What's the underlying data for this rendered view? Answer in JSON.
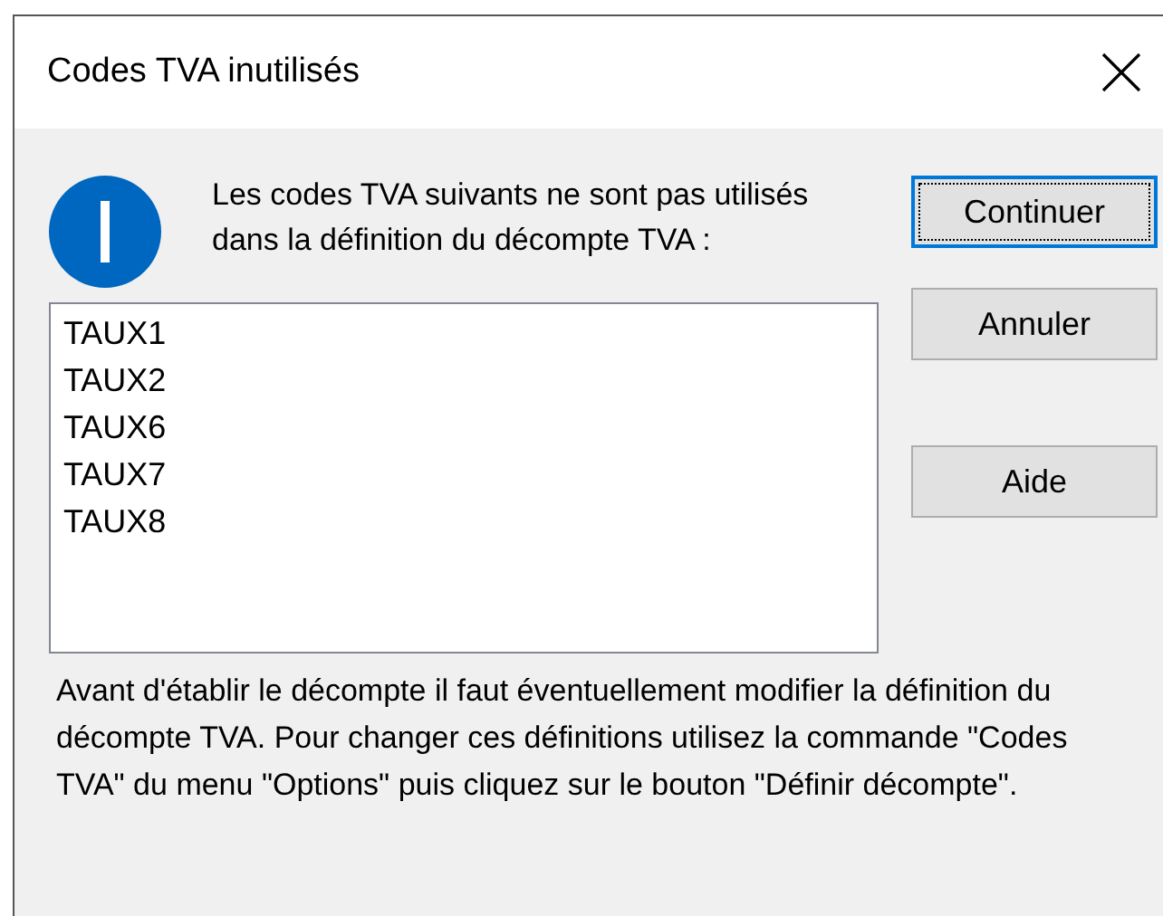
{
  "window": {
    "title": "Codes TVA inutilisés"
  },
  "message": "Les codes TVA suivants ne sont pas utilisés dans la définition du décompte TVA :",
  "codes": [
    "TAUX1",
    "TAUX2",
    "TAUX6",
    "TAUX7",
    "TAUX8"
  ],
  "buttons": [
    {
      "label": "Continuer",
      "default": true
    },
    {
      "label": "Annuler",
      "default": false
    },
    {
      "label": "Aide",
      "default": false
    }
  ],
  "note": "Avant d'établir le décompte il faut éventuellement modifier la définition du décompte TVA. Pour changer ces définitions utilisez la commande \"Codes TVA\" du menu \"Options\" puis cliquez sur le bouton \"Définir décompte\"."
}
